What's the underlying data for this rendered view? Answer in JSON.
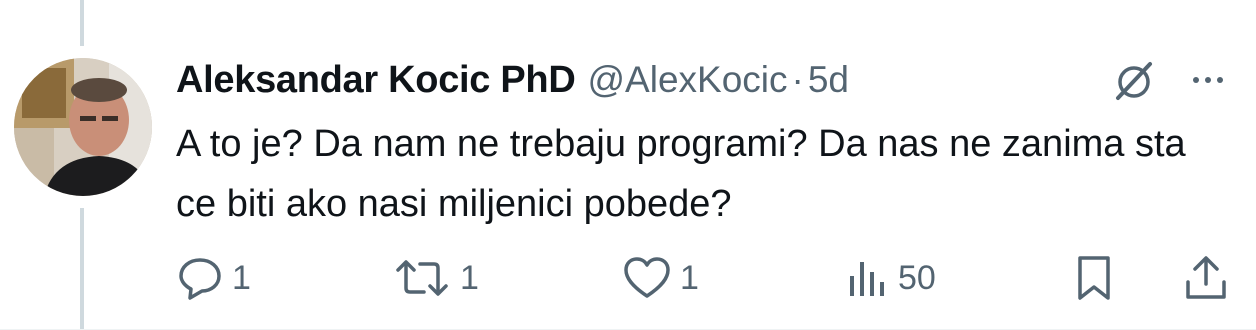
{
  "tweet": {
    "author_name": "Aleksandar Kocic PhD",
    "handle": "@AlexKocic",
    "separator": "·",
    "time": "5d",
    "text": "A to je? Da nam ne trebaju programi? Da nas ne zanima sta ce biti ako nasi miljenici pobede?"
  },
  "actions": {
    "reply_count": "1",
    "retweet_count": "1",
    "like_count": "1",
    "views_count": "50"
  },
  "icons": {
    "reply": "speech-bubble-icon",
    "retweet": "retweet-arrows-icon",
    "like": "heart-icon",
    "views": "bar-chart-icon",
    "bookmark": "bookmark-icon",
    "share": "share-upload-icon",
    "grok": "grok-slash-icon",
    "more": "ellipsis-icon"
  },
  "colors": {
    "text_primary": "#0f1419",
    "text_secondary": "#536471",
    "thread_line": "#cfd9de"
  }
}
